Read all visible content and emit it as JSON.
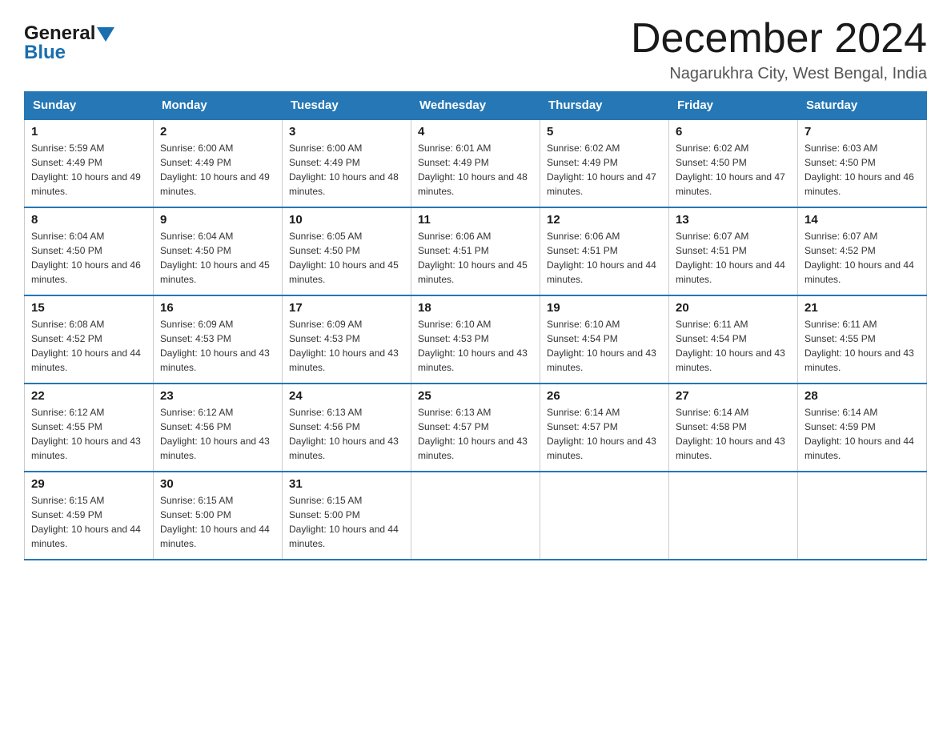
{
  "header": {
    "logo": {
      "general": "General",
      "blue": "Blue",
      "alt": "GeneralBlue logo"
    },
    "title": "December 2024",
    "location": "Nagarukhra City, West Bengal, India"
  },
  "calendar": {
    "days_of_week": [
      "Sunday",
      "Monday",
      "Tuesday",
      "Wednesday",
      "Thursday",
      "Friday",
      "Saturday"
    ],
    "weeks": [
      [
        {
          "day": "1",
          "sunrise": "5:59 AM",
          "sunset": "4:49 PM",
          "daylight": "10 hours and 49 minutes."
        },
        {
          "day": "2",
          "sunrise": "6:00 AM",
          "sunset": "4:49 PM",
          "daylight": "10 hours and 49 minutes."
        },
        {
          "day": "3",
          "sunrise": "6:00 AM",
          "sunset": "4:49 PM",
          "daylight": "10 hours and 48 minutes."
        },
        {
          "day": "4",
          "sunrise": "6:01 AM",
          "sunset": "4:49 PM",
          "daylight": "10 hours and 48 minutes."
        },
        {
          "day": "5",
          "sunrise": "6:02 AM",
          "sunset": "4:49 PM",
          "daylight": "10 hours and 47 minutes."
        },
        {
          "day": "6",
          "sunrise": "6:02 AM",
          "sunset": "4:50 PM",
          "daylight": "10 hours and 47 minutes."
        },
        {
          "day": "7",
          "sunrise": "6:03 AM",
          "sunset": "4:50 PM",
          "daylight": "10 hours and 46 minutes."
        }
      ],
      [
        {
          "day": "8",
          "sunrise": "6:04 AM",
          "sunset": "4:50 PM",
          "daylight": "10 hours and 46 minutes."
        },
        {
          "day": "9",
          "sunrise": "6:04 AM",
          "sunset": "4:50 PM",
          "daylight": "10 hours and 45 minutes."
        },
        {
          "day": "10",
          "sunrise": "6:05 AM",
          "sunset": "4:50 PM",
          "daylight": "10 hours and 45 minutes."
        },
        {
          "day": "11",
          "sunrise": "6:06 AM",
          "sunset": "4:51 PM",
          "daylight": "10 hours and 45 minutes."
        },
        {
          "day": "12",
          "sunrise": "6:06 AM",
          "sunset": "4:51 PM",
          "daylight": "10 hours and 44 minutes."
        },
        {
          "day": "13",
          "sunrise": "6:07 AM",
          "sunset": "4:51 PM",
          "daylight": "10 hours and 44 minutes."
        },
        {
          "day": "14",
          "sunrise": "6:07 AM",
          "sunset": "4:52 PM",
          "daylight": "10 hours and 44 minutes."
        }
      ],
      [
        {
          "day": "15",
          "sunrise": "6:08 AM",
          "sunset": "4:52 PM",
          "daylight": "10 hours and 44 minutes."
        },
        {
          "day": "16",
          "sunrise": "6:09 AM",
          "sunset": "4:53 PM",
          "daylight": "10 hours and 43 minutes."
        },
        {
          "day": "17",
          "sunrise": "6:09 AM",
          "sunset": "4:53 PM",
          "daylight": "10 hours and 43 minutes."
        },
        {
          "day": "18",
          "sunrise": "6:10 AM",
          "sunset": "4:53 PM",
          "daylight": "10 hours and 43 minutes."
        },
        {
          "day": "19",
          "sunrise": "6:10 AM",
          "sunset": "4:54 PM",
          "daylight": "10 hours and 43 minutes."
        },
        {
          "day": "20",
          "sunrise": "6:11 AM",
          "sunset": "4:54 PM",
          "daylight": "10 hours and 43 minutes."
        },
        {
          "day": "21",
          "sunrise": "6:11 AM",
          "sunset": "4:55 PM",
          "daylight": "10 hours and 43 minutes."
        }
      ],
      [
        {
          "day": "22",
          "sunrise": "6:12 AM",
          "sunset": "4:55 PM",
          "daylight": "10 hours and 43 minutes."
        },
        {
          "day": "23",
          "sunrise": "6:12 AM",
          "sunset": "4:56 PM",
          "daylight": "10 hours and 43 minutes."
        },
        {
          "day": "24",
          "sunrise": "6:13 AM",
          "sunset": "4:56 PM",
          "daylight": "10 hours and 43 minutes."
        },
        {
          "day": "25",
          "sunrise": "6:13 AM",
          "sunset": "4:57 PM",
          "daylight": "10 hours and 43 minutes."
        },
        {
          "day": "26",
          "sunrise": "6:14 AM",
          "sunset": "4:57 PM",
          "daylight": "10 hours and 43 minutes."
        },
        {
          "day": "27",
          "sunrise": "6:14 AM",
          "sunset": "4:58 PM",
          "daylight": "10 hours and 43 minutes."
        },
        {
          "day": "28",
          "sunrise": "6:14 AM",
          "sunset": "4:59 PM",
          "daylight": "10 hours and 44 minutes."
        }
      ],
      [
        {
          "day": "29",
          "sunrise": "6:15 AM",
          "sunset": "4:59 PM",
          "daylight": "10 hours and 44 minutes."
        },
        {
          "day": "30",
          "sunrise": "6:15 AM",
          "sunset": "5:00 PM",
          "daylight": "10 hours and 44 minutes."
        },
        {
          "day": "31",
          "sunrise": "6:15 AM",
          "sunset": "5:00 PM",
          "daylight": "10 hours and 44 minutes."
        },
        null,
        null,
        null,
        null
      ]
    ]
  }
}
